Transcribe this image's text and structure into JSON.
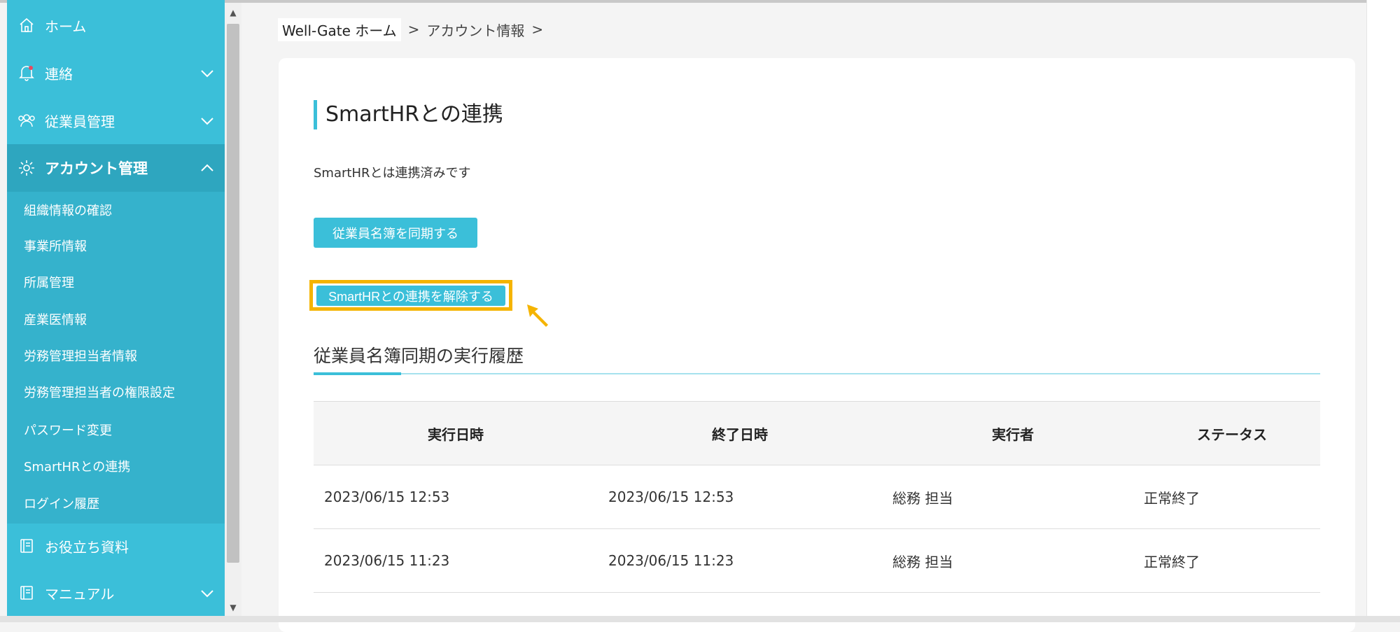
{
  "sidebar": {
    "items": [
      {
        "label": "ホーム",
        "icon": "home-icon"
      },
      {
        "label": "連絡",
        "icon": "bell-icon"
      },
      {
        "label": "従業員管理",
        "icon": "users-icon"
      },
      {
        "label": "アカウント管理",
        "icon": "gear-icon"
      },
      {
        "label": "お役立ち資料",
        "icon": "book-icon"
      },
      {
        "label": "マニュアル",
        "icon": "book-icon"
      }
    ],
    "submenu": [
      "組織情報の確認",
      "事業所情報",
      "所属管理",
      "産業医情報",
      "労務管理担当者情報",
      "労務管理担当者の権限設定",
      "パスワード変更",
      "SmartHRとの連携",
      "ログイン履歴"
    ]
  },
  "breadcrumb": {
    "home": "Well-Gate ホーム",
    "account": "アカウント情報",
    "sep": ">"
  },
  "main": {
    "title": "SmartHRとの連携",
    "status": "SmartHRとは連携済みです",
    "sync_button": "従業員名簿を同期する",
    "unlink_button": "SmartHRとの連携を解除する",
    "history_title": "従業員名簿同期の実行履歴"
  },
  "table": {
    "headers": [
      "実行日時",
      "終了日時",
      "実行者",
      "ステータス"
    ],
    "rows": [
      [
        "2023/06/15 12:53",
        "2023/06/15 12:53",
        "総務 担当",
        "正常終了"
      ],
      [
        "2023/06/15 11:23",
        "2023/06/15 11:23",
        "総務 担当",
        "正常終了"
      ]
    ]
  },
  "colors": {
    "accent": "#3bbfd9",
    "highlight": "#f5b400"
  }
}
